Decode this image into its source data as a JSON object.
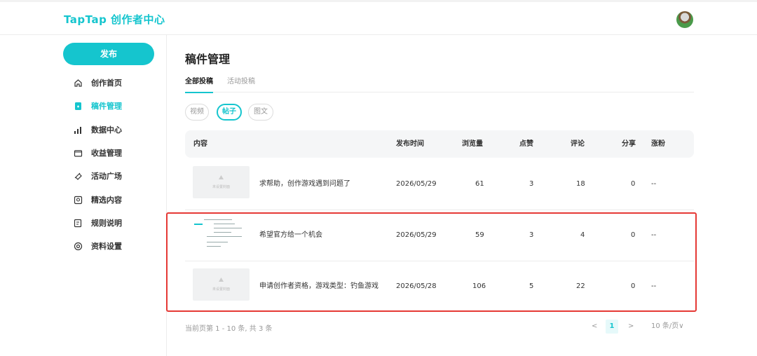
{
  "header": {
    "logo": "TapTap 创作者中心",
    "avatar": "user-avatar"
  },
  "sidebar": {
    "publish_label": "发布",
    "items": [
      {
        "label": "创作首页",
        "icon": "home-icon",
        "active": false
      },
      {
        "label": "稿件管理",
        "icon": "document-icon",
        "active": true
      },
      {
        "label": "数据中心",
        "icon": "bar-chart-icon",
        "active": false
      },
      {
        "label": "收益管理",
        "icon": "wallet-icon",
        "active": false
      },
      {
        "label": "活动广场",
        "icon": "megaphone-icon",
        "active": false
      },
      {
        "label": "精选内容",
        "icon": "star-icon",
        "active": false
      },
      {
        "label": "规则说明",
        "icon": "rules-icon",
        "active": false
      },
      {
        "label": "资料设置",
        "icon": "settings-icon",
        "active": false
      }
    ]
  },
  "main": {
    "title": "稿件管理",
    "tabs": [
      {
        "label": "全部投稿",
        "active": true
      },
      {
        "label": "活动投稿",
        "active": false
      }
    ],
    "filters": [
      {
        "label": "视频",
        "active": false
      },
      {
        "label": "帖子",
        "active": true
      },
      {
        "label": "图文",
        "active": false
      }
    ],
    "table": {
      "columns": [
        "内容",
        "发布时间",
        "浏览量",
        "点赞",
        "评论",
        "分享",
        "涨粉"
      ],
      "rows": [
        {
          "thumb_label": "未设置封面",
          "title": "求帮助，创作游戏遇到问题了",
          "date": "2026/05/29",
          "views": "61",
          "likes": "3",
          "comments": "18",
          "shares": "0",
          "fans": "--"
        },
        {
          "thumb_label": "",
          "title": "希望官方给一个机会",
          "date": "2026/05/29",
          "views": "59",
          "likes": "3",
          "comments": "4",
          "shares": "0",
          "fans": "--"
        },
        {
          "thumb_label": "未设置封面",
          "title": "申请创作者资格，游戏类型：钓鱼游戏",
          "date": "2026/05/28",
          "views": "106",
          "likes": "5",
          "comments": "22",
          "shares": "0",
          "fans": "--"
        }
      ]
    },
    "footer": {
      "summary": "当前页第 1 - 10 条, 共 3 条",
      "prev": "<",
      "page": "1",
      "next": ">",
      "page_size": "10 条/页∨"
    }
  },
  "colors": {
    "accent": "#15c5ce",
    "highlight": "#e53935"
  }
}
